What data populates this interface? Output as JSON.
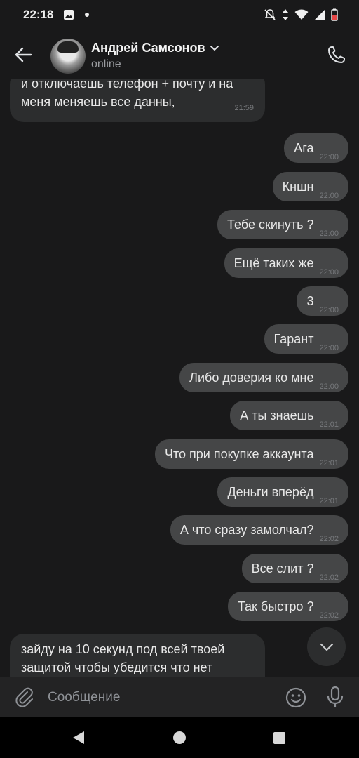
{
  "statusbar": {
    "time": "22:18"
  },
  "header": {
    "name": "Андрей Самсонов",
    "status": "online"
  },
  "messages": [
    {
      "dir": "in",
      "text": "и отключаешь телефон + почту и на меня меняешь все данны,",
      "time": "21:59"
    },
    {
      "dir": "out",
      "text": "Ага",
      "time": "22:00"
    },
    {
      "dir": "out",
      "text": "Кншн",
      "time": "22:00"
    },
    {
      "dir": "out",
      "text": "Тебе скинуть ?",
      "time": "22:00"
    },
    {
      "dir": "out",
      "text": "Ещё таких же",
      "time": "22:00"
    },
    {
      "dir": "out",
      "text": "3",
      "time": "22:00"
    },
    {
      "dir": "out",
      "text": "Гарант",
      "time": "22:00"
    },
    {
      "dir": "out",
      "text": "Либо доверия ко мне",
      "time": "22:00"
    },
    {
      "dir": "out",
      "text": "А ты знаешь",
      "time": "22:01"
    },
    {
      "dir": "out",
      "text": "Что при покупке аккаунта",
      "time": "22:01"
    },
    {
      "dir": "out",
      "text": "Деньги вперёд",
      "time": "22:01"
    },
    {
      "dir": "out",
      "text": "А что сразу замолчал?",
      "time": "22:02"
    },
    {
      "dir": "out",
      "text": "Все слит ?",
      "time": "22:02"
    },
    {
      "dir": "out",
      "text": "Так быстро ?",
      "time": "22:02"
    },
    {
      "dir": "in",
      "text": "зайду на 10 секунд под всей твоей защитой чтобы убедится что нет",
      "time": ""
    }
  ],
  "composer": {
    "placeholder": "Сообщение"
  },
  "icons": {
    "back": "arrow-left-icon",
    "call": "phone-icon",
    "attach": "paperclip-icon",
    "emoji": "smile-icon",
    "mic": "microphone-icon",
    "scroll": "chevron-down-icon"
  },
  "colors": {
    "background": "#19191a",
    "bubble_out": "#454647",
    "bubble_in": "#2c2d2e",
    "composer": "#232324"
  }
}
